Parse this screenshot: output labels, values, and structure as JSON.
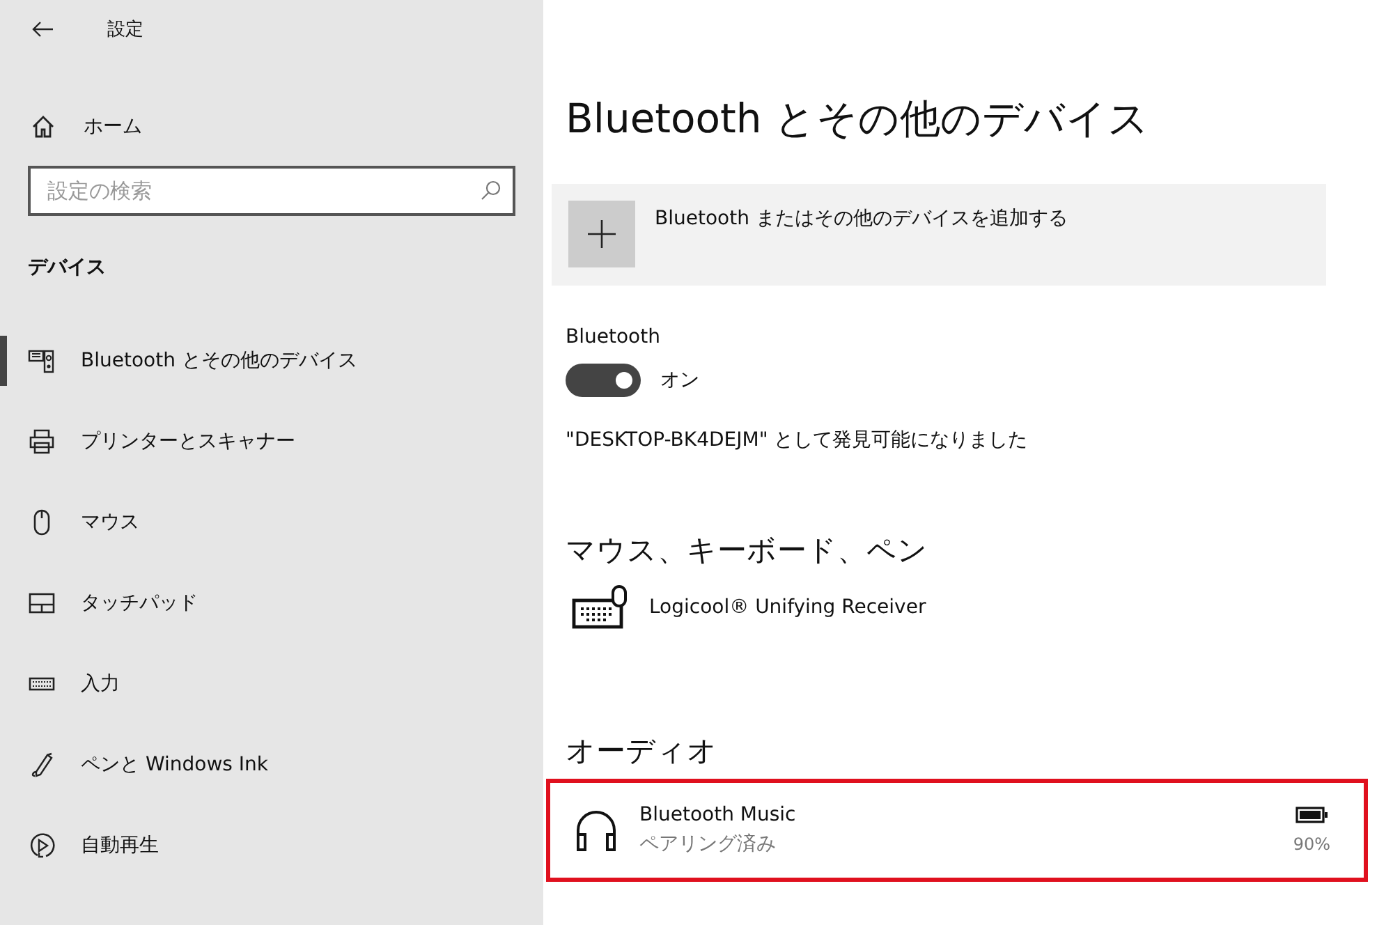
{
  "window": {
    "title": "設定"
  },
  "sidebar": {
    "home": "ホーム",
    "search": {
      "placeholder": "設定の検索"
    },
    "section": "デバイス",
    "items": [
      {
        "label": "Bluetooth とその他のデバイス",
        "kind": "bluetooth",
        "selected": true
      },
      {
        "label": "プリンターとスキャナー",
        "kind": "printer",
        "selected": false
      },
      {
        "label": "マウス",
        "kind": "mouse",
        "selected": false
      },
      {
        "label": "タッチパッド",
        "kind": "touchpad",
        "selected": false
      },
      {
        "label": "入力",
        "kind": "keyboard",
        "selected": false
      },
      {
        "label": "ペンと Windows Ink",
        "kind": "pen",
        "selected": false
      },
      {
        "label": "自動再生",
        "kind": "autoplay",
        "selected": false
      }
    ]
  },
  "page": {
    "title": "Bluetooth とその他のデバイス",
    "add_button": "Bluetooth またはその他のデバイスを追加する",
    "bluetooth": {
      "label": "Bluetooth",
      "on": true,
      "state_text": "オン"
    },
    "discoverable": "\"DESKTOP-BK4DEJM\" として発見可能になりました",
    "sections": [
      {
        "title": "マウス、キーボード、ペン",
        "devices": [
          {
            "name": "Logicool® Unifying Receiver",
            "kind": "keyboard",
            "highlighted": false
          }
        ]
      },
      {
        "title": "オーディオ",
        "devices": [
          {
            "name": "Bluetooth Music",
            "kind": "headphones",
            "status": "ペアリング済み",
            "battery": "90%",
            "highlighted": true
          }
        ]
      }
    ]
  }
}
